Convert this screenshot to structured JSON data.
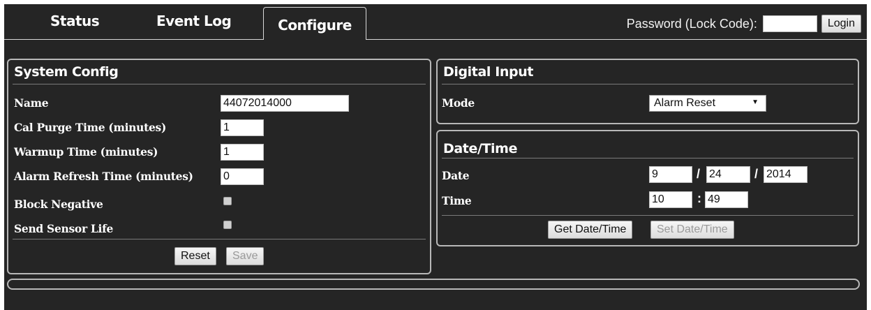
{
  "tabs": [
    {
      "label": "Status"
    },
    {
      "label": "Event Log"
    },
    {
      "label": "Configure"
    }
  ],
  "auth": {
    "label": "Password (Lock Code):",
    "value": "",
    "login_label": "Login"
  },
  "system_config": {
    "title": "System Config",
    "fields": [
      {
        "label": "Name",
        "value": "44072014000"
      },
      {
        "label": "Cal Purge Time (minutes)",
        "value": "1"
      },
      {
        "label": "Warmup Time (minutes)",
        "value": "1"
      },
      {
        "label": "Alarm Refresh Time (minutes)",
        "value": "0"
      }
    ],
    "checks": [
      {
        "label": "Block Negative",
        "checked": false
      },
      {
        "label": "Send Sensor Life",
        "checked": false
      }
    ],
    "reset_label": "Reset",
    "save_label": "Save"
  },
  "digital_input": {
    "title": "Digital Input",
    "mode_label": "Mode",
    "mode_value": "Alarm Reset"
  },
  "date_time": {
    "title": "Date/Time",
    "date_label": "Date",
    "month": "9",
    "day": "24",
    "year": "2014",
    "time_label": "Time",
    "hour": "10",
    "minute": "49",
    "date_sep": "/",
    "time_sep": ":",
    "get_label": "Get Date/Time",
    "set_label": "Set Date/Time"
  }
}
